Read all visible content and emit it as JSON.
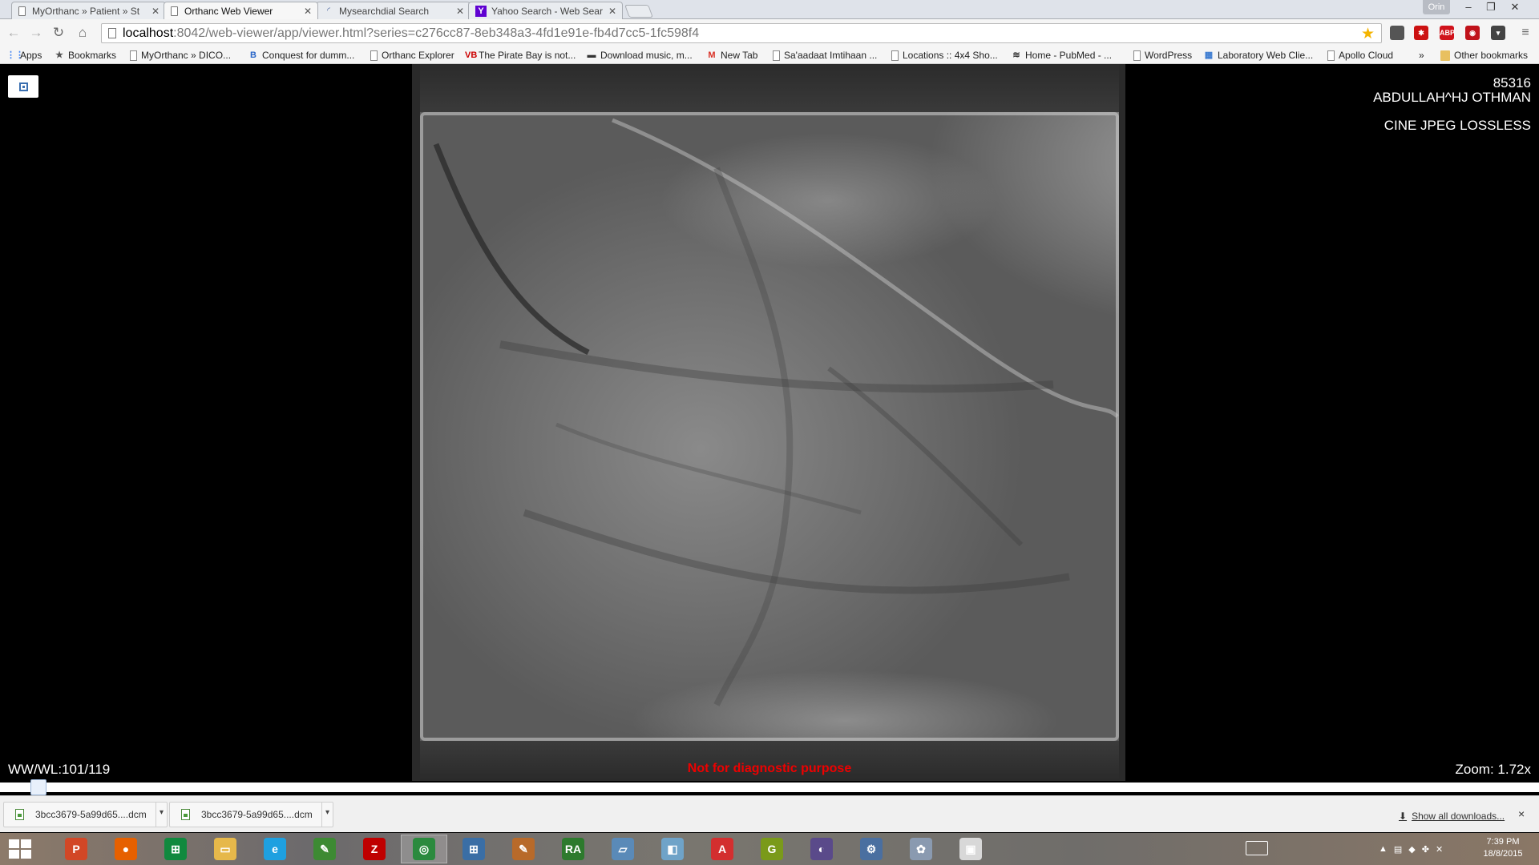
{
  "browser": {
    "tabs": [
      {
        "title": "MyOrthanc » Patient » St",
        "active": false,
        "icon": "document-icon"
      },
      {
        "title": "Orthanc Web Viewer",
        "active": true,
        "icon": "document-icon"
      },
      {
        "title": "Mysearchdial Search",
        "active": false,
        "icon": "mysearchdial-icon"
      },
      {
        "title": "Yahoo Search - Web Sear",
        "active": false,
        "icon": "yahoo-icon"
      }
    ],
    "profile_name": "Orin",
    "url_host": "localhost",
    "url_rest": ":8042/web-viewer/app/viewer.html?series=c276cc87-8eb348a3-4fd1e91e-fb4d7cc5-1fc598f4",
    "extensions": [
      {
        "name": "extension-icon",
        "label": "",
        "color": "#555555"
      },
      {
        "name": "lastpass-icon",
        "label": "✱",
        "color": "#cc1111"
      },
      {
        "name": "adblock-icon",
        "label": "ABP",
        "color": "#d0121b"
      },
      {
        "name": "opera-icon",
        "label": "◉",
        "color": "#c0121a"
      },
      {
        "name": "pocket-icon",
        "label": "▾",
        "color": "#444444"
      }
    ]
  },
  "bookmarks": {
    "items": [
      {
        "label": "Apps",
        "icon": "apps-icon"
      },
      {
        "label": "Bookmarks",
        "icon": "star-icon"
      },
      {
        "label": "MyOrthanc » DICO...",
        "icon": "document-icon"
      },
      {
        "label": "Conquest for dumm...",
        "icon": "blogger-icon"
      },
      {
        "label": "Orthanc Explorer",
        "icon": "document-icon"
      },
      {
        "label": "The Pirate Bay is not...",
        "icon": "vb-icon"
      },
      {
        "label": "Download music, m...",
        "icon": "download-icon"
      },
      {
        "label": "New Tab",
        "icon": "gmail-icon"
      },
      {
        "label": "Sa'aadaat Imtihaan ...",
        "icon": "document-icon"
      },
      {
        "label": "Locations :: 4x4 Sho...",
        "icon": "document-icon"
      },
      {
        "label": "Home - PubMed - ...",
        "icon": "pubmed-icon"
      },
      {
        "label": "WordPress",
        "icon": "document-icon"
      },
      {
        "label": "Laboratory Web Clie...",
        "icon": "lab-icon"
      },
      {
        "label": "Apollo Cloud",
        "icon": "document-icon"
      }
    ],
    "more": "»",
    "other": "Other bookmarks"
  },
  "viewer": {
    "patient_id": "85316",
    "patient_name": "ABDULLAH^HJ OTHMAN",
    "series_description": "CINE JPEG LOSSLESS",
    "window_level": "WW/WL:101/119",
    "zoom": "Zoom: 1.72x",
    "disclaimer": "Not for diagnostic purpose",
    "frame_position": 0.02
  },
  "downloads": {
    "items": [
      {
        "name": "3bcc3679-5a99d65....dcm"
      },
      {
        "name": "3bcc3679-5a99d65....dcm"
      }
    ],
    "show_all": "Show all downloads...",
    "close": "×"
  },
  "taskbar": {
    "apps": [
      {
        "name": "powerpoint-icon",
        "label": "P",
        "color": "#d24726"
      },
      {
        "name": "firefox-icon",
        "label": "●",
        "color": "#e66000"
      },
      {
        "name": "store-icon",
        "label": "⊞",
        "color": "#10893e"
      },
      {
        "name": "file-explorer-icon",
        "label": "▭",
        "color": "#e6b84a"
      },
      {
        "name": "internet-explorer-icon",
        "label": "e",
        "color": "#1ea0e0"
      },
      {
        "name": "evernote-icon",
        "label": "✎",
        "color": "#3d8a33"
      },
      {
        "name": "filezilla-icon",
        "label": "Z",
        "color": "#bf0000"
      },
      {
        "name": "chrome-icon",
        "label": "◎",
        "color": "#2b8a3e"
      },
      {
        "name": "network-icon",
        "label": "⊞",
        "color": "#3a6ea5"
      },
      {
        "name": "tool-icon",
        "label": "✎",
        "color": "#b86a2a"
      },
      {
        "name": "radiant-icon",
        "label": "RA",
        "color": "#2d7a2d"
      },
      {
        "name": "scanner-icon",
        "label": "▱",
        "color": "#5a8ab8"
      },
      {
        "name": "notes-icon",
        "label": "◧",
        "color": "#6fa3c8"
      },
      {
        "name": "acrobat-icon",
        "label": "A",
        "color": "#d32f2f"
      },
      {
        "name": "grammarly-icon",
        "label": "G",
        "color": "#7a9a1a"
      },
      {
        "name": "eclipse-icon",
        "label": "◐",
        "color": "#5a4a8a"
      },
      {
        "name": "settings-icon",
        "label": "⚙",
        "color": "#4a6fa0"
      },
      {
        "name": "paint-icon",
        "label": "✿",
        "color": "#8a9ab0"
      },
      {
        "name": "snipping-icon",
        "label": "▣",
        "color": "#d8d8d8"
      }
    ],
    "time": "7:39 PM",
    "date": "18/8/2015"
  }
}
